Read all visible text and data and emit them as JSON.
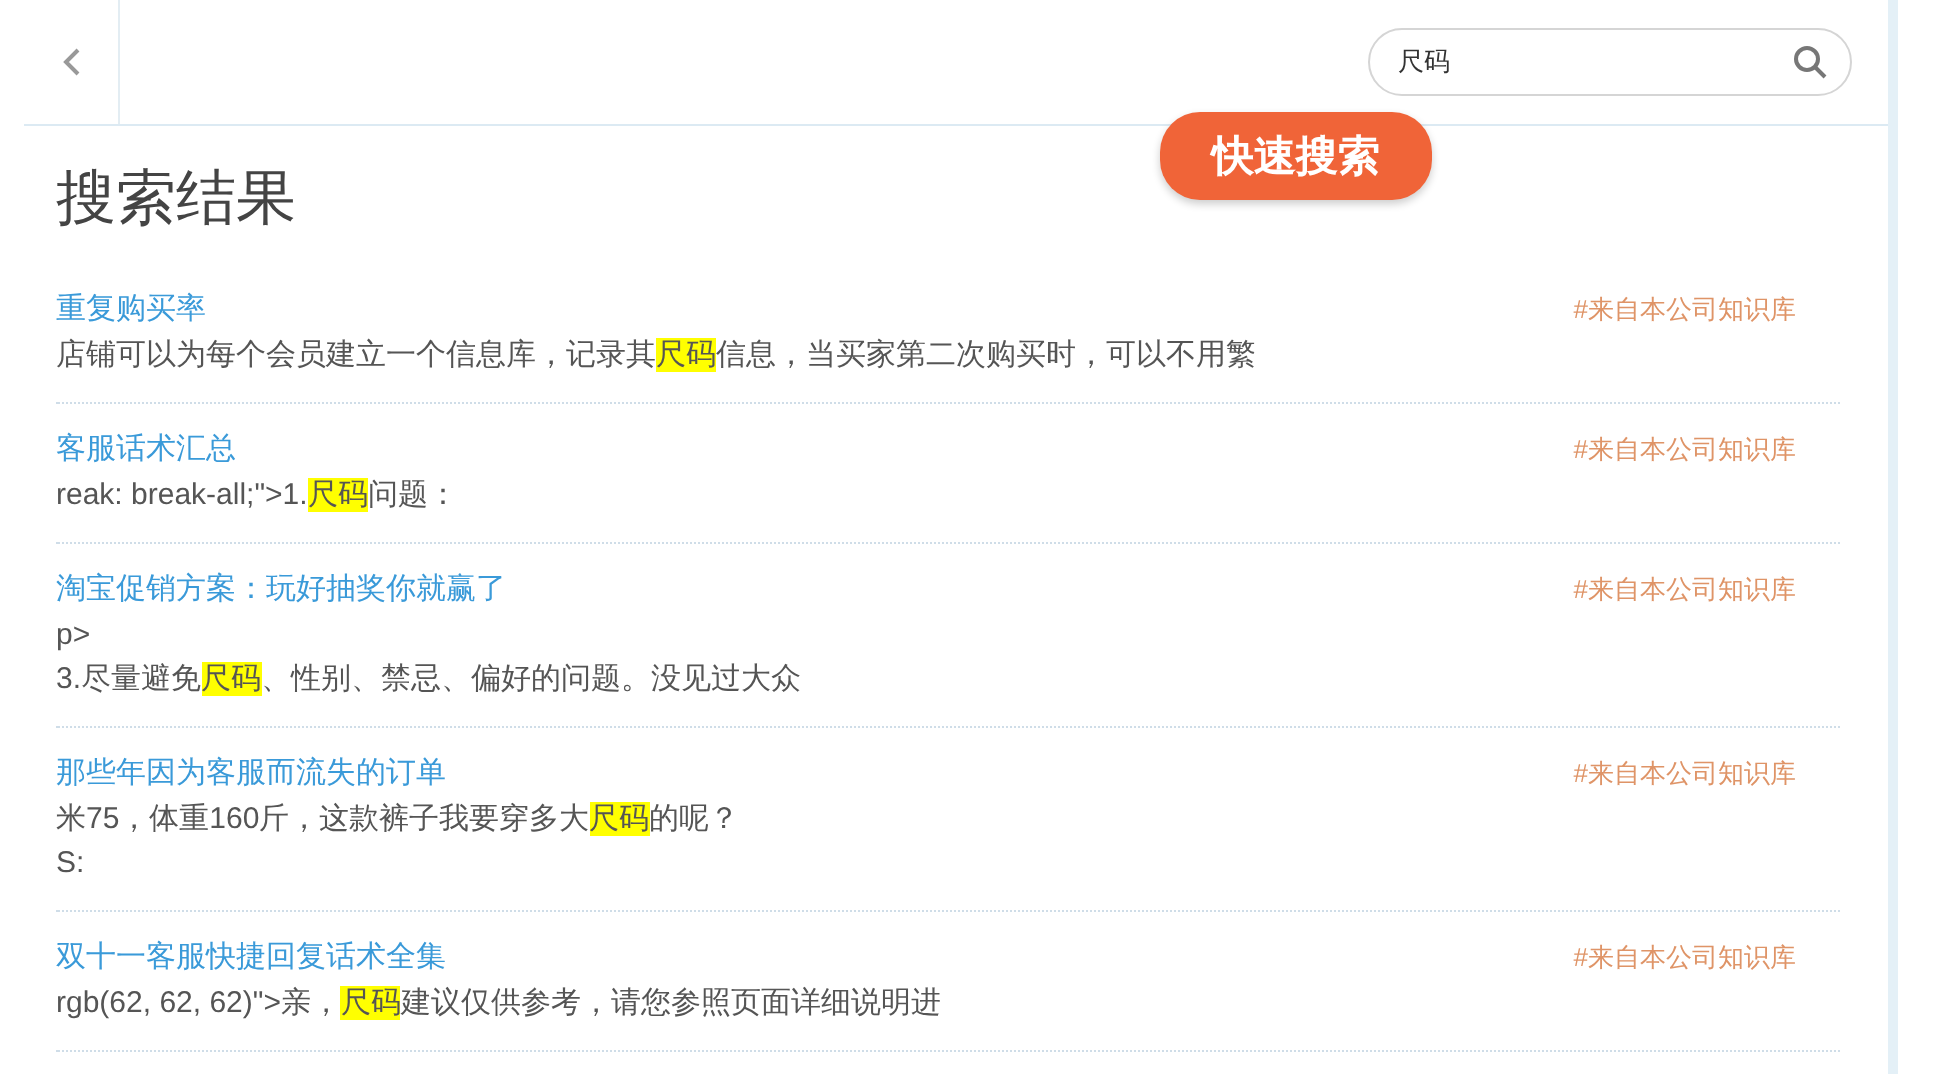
{
  "search": {
    "value": "尺码"
  },
  "tooltip": "快速搜索",
  "heading": "搜索结果",
  "results": [
    {
      "title": "重复购买率",
      "source": "#来自本公司知识库",
      "lines": [
        [
          {
            "text": "店铺可以为每个会员建立一个信息库，记录其",
            "highlight": false
          },
          {
            "text": "尺码",
            "highlight": true
          },
          {
            "text": "信息，当买家第二次购买时，可以不用繁",
            "highlight": false
          }
        ]
      ]
    },
    {
      "title": "客服话术汇总",
      "source": "#来自本公司知识库",
      "lines": [
        [
          {
            "text": "reak: break-all;\">1.",
            "highlight": false
          },
          {
            "text": "尺码",
            "highlight": true
          },
          {
            "text": "问题：",
            "highlight": false
          }
        ]
      ]
    },
    {
      "title": "淘宝促销方案：玩好抽奖你就赢了",
      "source": "#来自本公司知识库",
      "lines": [
        [
          {
            "text": "p>",
            "highlight": false
          }
        ],
        [
          {
            "text": "3.尽量避免",
            "highlight": false
          },
          {
            "text": "尺码",
            "highlight": true
          },
          {
            "text": "、性别、禁忌、偏好的问题。没见过大众",
            "highlight": false
          }
        ]
      ]
    },
    {
      "title": "那些年因为客服而流失的订单",
      "source": "#来自本公司知识库",
      "lines": [
        [
          {
            "text": "米75，体重160斤，这款裤子我要穿多大",
            "highlight": false
          },
          {
            "text": "尺码",
            "highlight": true
          },
          {
            "text": "的呢？",
            "highlight": false
          }
        ],
        [
          {
            "text": "S:",
            "highlight": false
          }
        ]
      ]
    },
    {
      "title": "双十一客服快捷回复话术全集",
      "source": "#来自本公司知识库",
      "lines": [
        [
          {
            "text": "rgb(62, 62, 62)\">亲，",
            "highlight": false
          },
          {
            "text": "尺码",
            "highlight": true
          },
          {
            "text": "建议仅供参考，请您参照页面详细说明进",
            "highlight": false
          }
        ]
      ]
    }
  ]
}
